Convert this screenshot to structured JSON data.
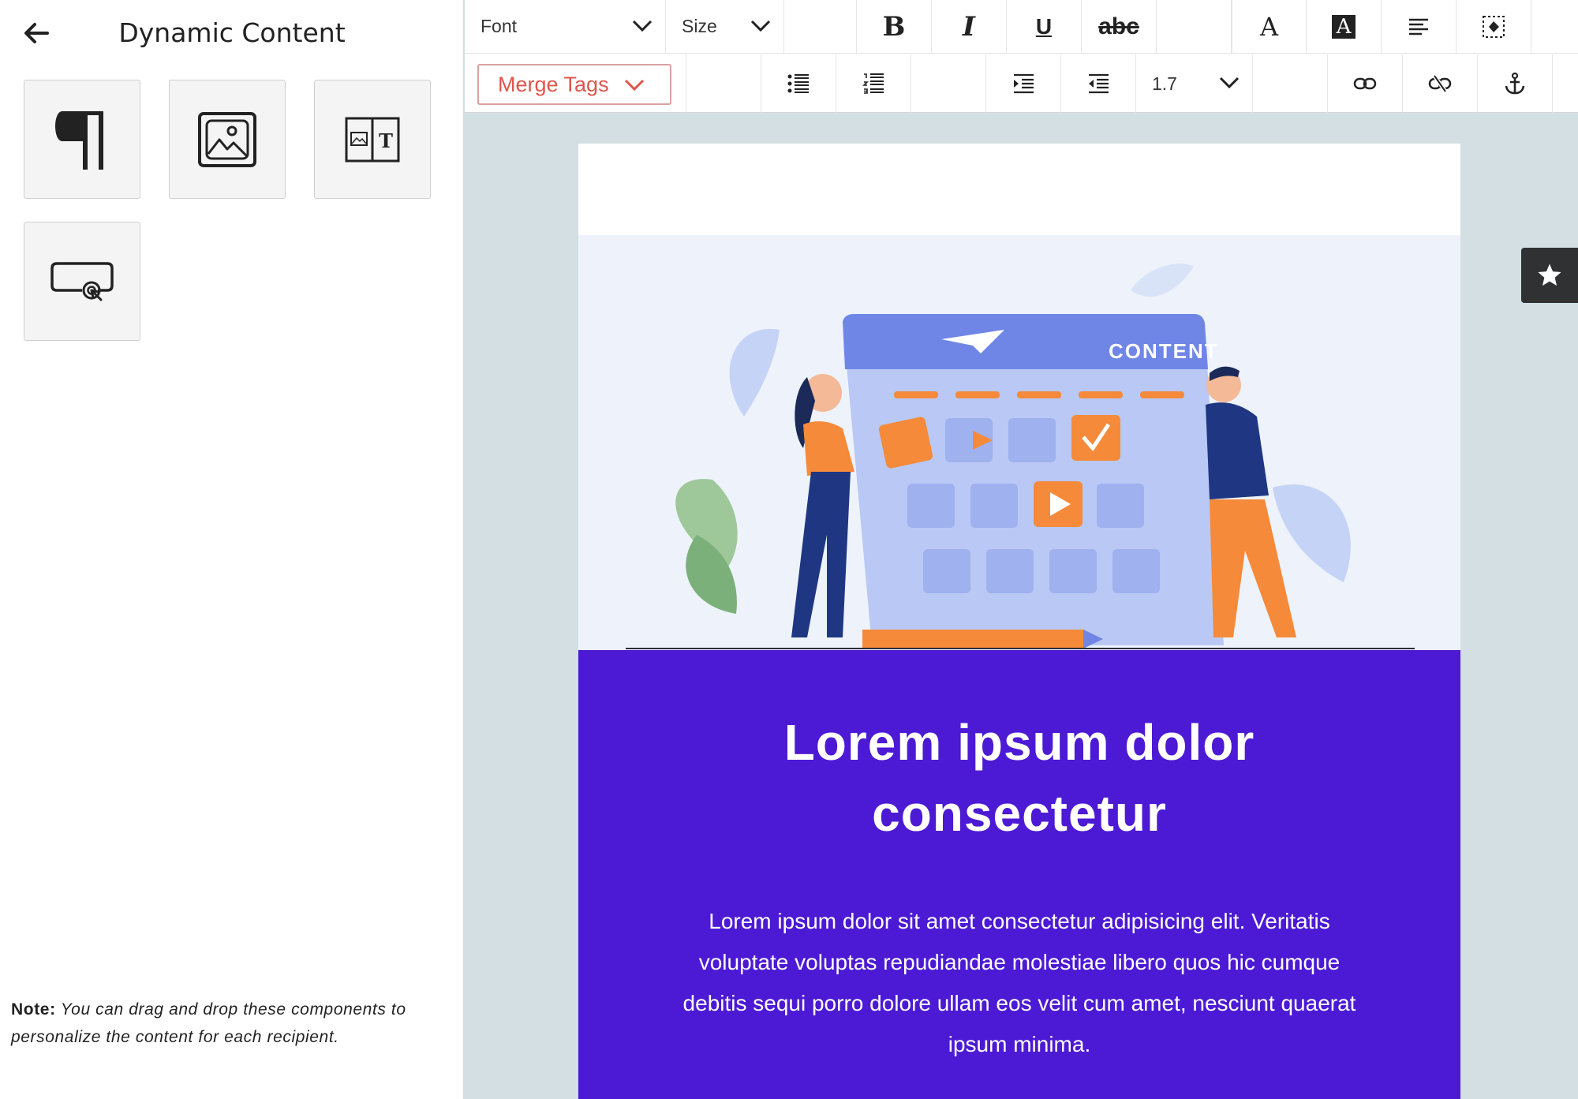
{
  "sidebar": {
    "title": "Dynamic Content",
    "tiles": [
      {
        "icon": "paragraph-icon"
      },
      {
        "icon": "image-icon"
      },
      {
        "icon": "image-text-icon"
      },
      {
        "icon": "button-click-icon"
      }
    ],
    "note": {
      "label": "Note:",
      "text": " You can drag and drop these components to personalize the content for each recipient."
    }
  },
  "toolbar": {
    "font_label": "Font",
    "size_label": "Size",
    "merge_tags_label": "Merge Tags",
    "line_height_value": "1.7",
    "strikethrough_label": "abc",
    "bold_label": "B",
    "italic_label": "I",
    "underline_label": "U",
    "font_color_label": "A",
    "bg_color_label": "A"
  },
  "email": {
    "hero_caption": "CONTENT",
    "headline": "Lorem ipsum dolor consectetur",
    "body": "Lorem ipsum dolor sit amet consectetur adipisicing elit. Veritatis voluptate voluptas repudiandae molestiae libero quos hic cumque debitis sequi porro dolore ullam eos velit cum amet, nesciunt quaerat ipsum minima."
  },
  "colors": {
    "brand_purple": "#4c1ad4",
    "merge_tags_red": "#e0554b",
    "canvas_bg": "#d3dfe3"
  }
}
